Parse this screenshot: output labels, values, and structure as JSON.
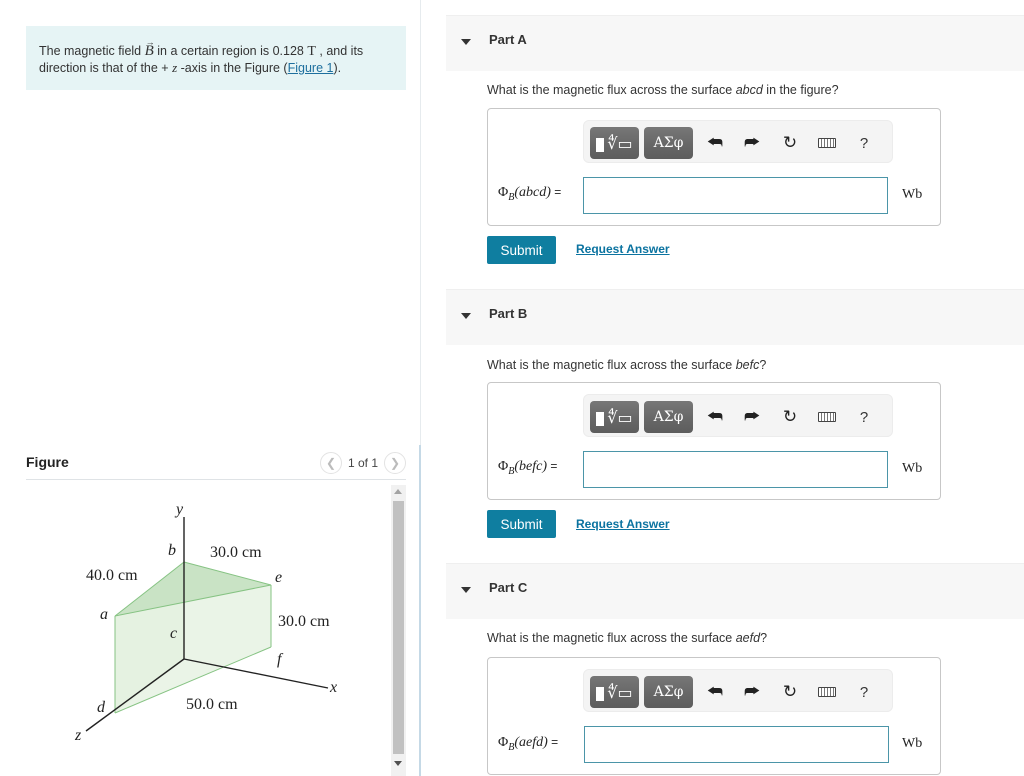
{
  "intro": {
    "text_1": "The magnetic field ",
    "symbol_B": "B",
    "text_2": " in a certain region is 0.128 ",
    "unit_T": "T",
    "text_3": " , and its direction is that of the + ",
    "symbol_z": "z",
    "text_4": " -axis in the Figure (",
    "figure_link": "Figure 1",
    "text_5": ")."
  },
  "figure": {
    "title": "Figure",
    "pager_text": "1 of 1",
    "prev_icon": "chevron-left-icon",
    "next_icon": "chevron-right-icon",
    "labels": {
      "y": "y",
      "x": "x",
      "z": "z",
      "a": "a",
      "b": "b",
      "c": "c",
      "d": "d",
      "e": "e",
      "f": "f",
      "dim_ab": "40.0 cm",
      "dim_be": "30.0 cm",
      "dim_ef": "30.0 cm",
      "dim_df": "50.0 cm"
    },
    "surface_color": "#cfe6cc",
    "edge_color": "#7cbf7a"
  },
  "toolbar": {
    "template_button": "templates",
    "symbols_button": "ΑΣφ",
    "undo_icon": "↶",
    "redo_icon": "↷",
    "reset_icon": "↻",
    "keyboard_icon": "keyboard",
    "help_icon": "?"
  },
  "parts": [
    {
      "title": "Part A",
      "question_prefix": "What is the magnetic flux across the surface ",
      "surface": "abcd",
      "question_suffix": " in the figure?",
      "eq_prefix": "Φ",
      "eq_sub": "B",
      "eq_arg": "(abcd)",
      "eq_sign": " =",
      "input_value": "",
      "unit": "Wb",
      "submit_label": "Submit",
      "request_label": "Request Answer"
    },
    {
      "title": "Part B",
      "question_prefix": "What is the magnetic flux across the surface ",
      "surface": "befc",
      "question_suffix": "?",
      "eq_prefix": "Φ",
      "eq_sub": "B",
      "eq_arg": "(befc)",
      "eq_sign": " =",
      "input_value": "",
      "unit": "Wb",
      "submit_label": "Submit",
      "request_label": "Request Answer"
    },
    {
      "title": "Part C",
      "question_prefix": "What is the magnetic flux across the surface ",
      "surface": "aefd",
      "question_suffix": "?",
      "eq_prefix": "Φ",
      "eq_sub": "B",
      "eq_arg": "(aefd)",
      "eq_sign": " =",
      "input_value": "",
      "unit": "Wb"
    }
  ],
  "colors": {
    "intro_bg": "#e6f4f5",
    "submit_bg": "#0f7ea0",
    "link": "#0b73a0",
    "input_border": "#4b95a8"
  }
}
